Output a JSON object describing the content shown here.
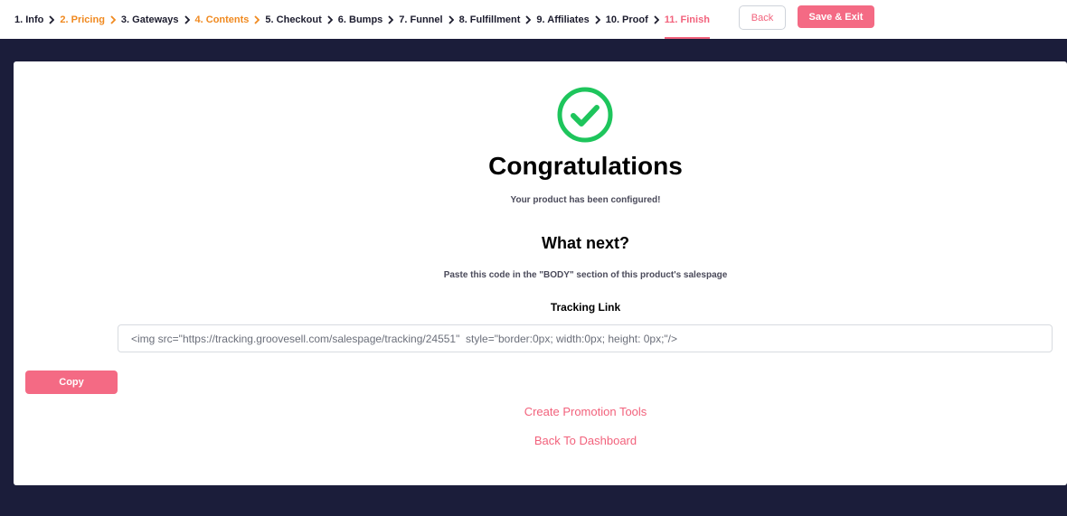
{
  "nav": {
    "steps": [
      {
        "label": "1. Info",
        "state": "done"
      },
      {
        "label": "2. Pricing",
        "state": "warn"
      },
      {
        "label": "3. Gateways",
        "state": "done"
      },
      {
        "label": "4. Contents",
        "state": "warn"
      },
      {
        "label": "5. Checkout",
        "state": "done"
      },
      {
        "label": "6. Bumps",
        "state": "done"
      },
      {
        "label": "7. Funnel",
        "state": "done"
      },
      {
        "label": "8. Fulfillment",
        "state": "done"
      },
      {
        "label": "9. Affiliates",
        "state": "done"
      },
      {
        "label": "10. Proof",
        "state": "done"
      },
      {
        "label": "11. Finish",
        "state": "active"
      }
    ],
    "back_label": "Back",
    "save_exit_label": "Save & Exit"
  },
  "finish": {
    "icon": "check-circle-icon",
    "title": "Congratulations",
    "subtitle": "Your product has been configured!",
    "what_next": "What next?",
    "instruction": "Paste this code in the \"BODY\" section of this product's salespage",
    "tracking_label": "Tracking Link",
    "tracking_code": "<img src=\"https://tracking.groovesell.com/salespage/tracking/24551\"  style=\"border:0px; width:0px; height: 0px;\"/>",
    "copy_label": "Copy",
    "promo_link": "Create Promotion Tools",
    "dashboard_link": "Back To Dashboard"
  },
  "colors": {
    "accent": "#f2627c",
    "warning": "#f0891f",
    "success": "#1ec55c",
    "backdrop": "#1b1d3a"
  }
}
